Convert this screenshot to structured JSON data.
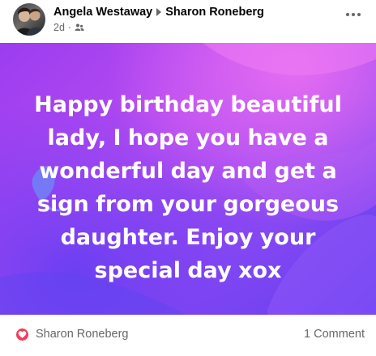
{
  "post": {
    "author": "Angela Westaway",
    "recipient": "Sharon Roneberg",
    "time": "2d",
    "audience_icon": "friends-icon",
    "more_icon": "more-options-icon",
    "message": "Happy birthday beautiful lady, I hope you have a wonderful day and get a sign from your gorgeous daughter. Enjoy your special day xox",
    "background_colors": [
      "#9b3df0",
      "#e56cf2",
      "#5a3cf0"
    ]
  },
  "footer": {
    "reaction_icon": "love-reaction-icon",
    "reaction_color": "#f33e58",
    "reactor_name": "Sharon Roneberg",
    "comment_count": "1 Comment"
  }
}
